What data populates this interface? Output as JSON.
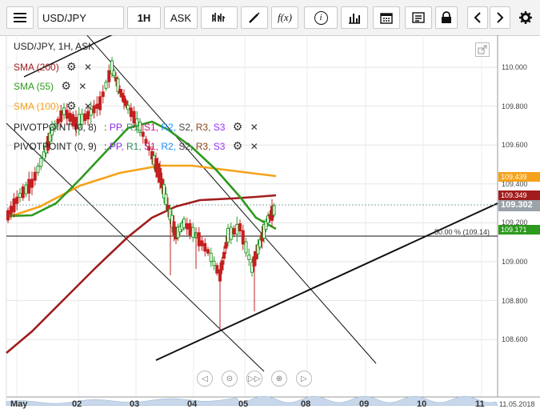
{
  "toolbar": {
    "symbol": "USD/JPY",
    "interval": "1H",
    "price_type": "ASK",
    "icons": [
      "menu-icon",
      "bar-style-icon",
      "draw-icon",
      "function-icon",
      "info-icon",
      "chart-type-icon",
      "calendar-icon",
      "report-icon",
      "lock-icon",
      "prev-icon",
      "next-icon",
      "gear-icon"
    ],
    "function_label": "f(x)",
    "info_label": "i"
  },
  "legend": {
    "title": "USD/JPY, 1H, ASK",
    "sma200": "SMA (200)",
    "sma55": "SMA (55)",
    "sma100": "SMA (100)",
    "pivot1_name": "PIVOTPOINT (0, 8)",
    "pivot2_name": "PIVOTPOINT (0, 9)",
    "pivot_sep": ":",
    "pivot_levels": [
      "PP",
      "R1",
      "S1",
      "R2",
      "S2",
      "R3",
      "S3"
    ]
  },
  "colors": {
    "sma200": "#a11d1d",
    "sma55": "#2c9a1c",
    "sma100": "#f5a21a",
    "price_up": "#2a9a2a",
    "price_down": "#c32020",
    "pp": "#8a2be2",
    "r1": "#2e8b57",
    "s1": "#c71585",
    "r2": "#1e90ff",
    "s2": "#444444",
    "r3": "#8b4513",
    "s3": "#9b30ff"
  },
  "price_axis": {
    "ticks": [
      "110.000",
      "109.800",
      "109.600",
      "109.400",
      "109.200",
      "109.000",
      "108.800",
      "108.600"
    ],
    "labels": [
      {
        "value": "109.439",
        "color": "#f5a21a"
      },
      {
        "value": "109.349",
        "color": "#a11d1d"
      },
      {
        "value": "109.302",
        "color": "#9aa3aa"
      },
      {
        "value": "109.171",
        "color": "#2c9a1c"
      }
    ]
  },
  "fib_label": "50.00 % (109.14)",
  "time_axis": {
    "labels": [
      "May",
      "02",
      "03",
      "04",
      "05",
      "08",
      "09",
      "10",
      "11"
    ],
    "date_stamp": "11.05.2018"
  },
  "nav_buttons": [
    "◁",
    "⊝",
    "▷▷",
    "⊕",
    "▷"
  ]
}
